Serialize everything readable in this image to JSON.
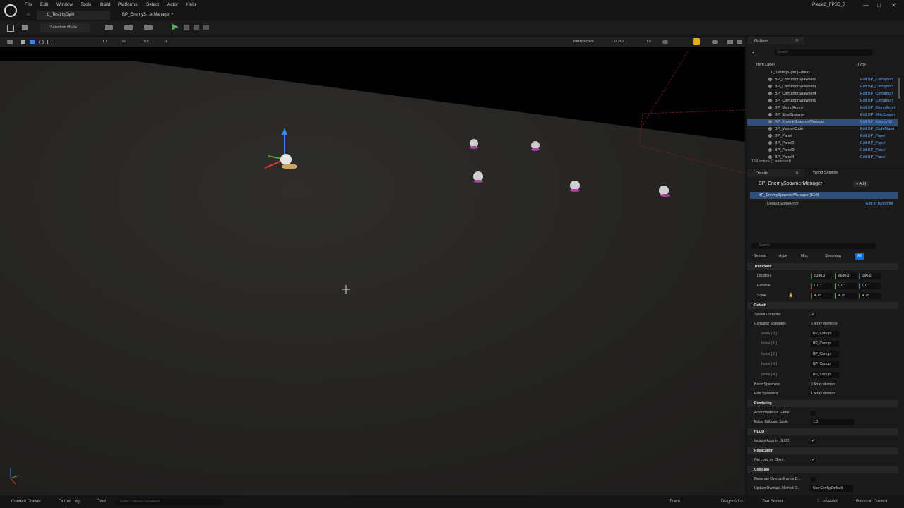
{
  "titlebar": {
    "menus": [
      "File",
      "Edit",
      "Window",
      "Tools",
      "Build",
      "Platforms",
      "Select",
      "Actor",
      "Help"
    ],
    "level_tab": "L_TestingGym",
    "bp_tab": "BP_EnemyS...erManager •",
    "project": "Piece2_FPS5_7",
    "win_min": "—",
    "win_max": "□",
    "win_close": "✕"
  },
  "toolbar": {
    "mode": "Selection Mode",
    "play": "▶"
  },
  "vp": {
    "perspective": "Perspective",
    "speed": "0.267",
    "lit": "Lit",
    "grid": "10",
    "rot": "10°",
    "fov": "50",
    "cam": "1"
  },
  "outliner": {
    "title": "Outliner",
    "search_placeholder": "Search",
    "col_label": "Item Label",
    "col_type": "Type",
    "root": "L_TestingGym (Editor)",
    "rows": [
      {
        "name": "BP_CorruptorSpawner2",
        "type": "Edit BP_Corruptor!"
      },
      {
        "name": "BP_CorruptorSpawner3",
        "type": "Edit BP_Corruptor!"
      },
      {
        "name": "BP_CorruptorSpawner4",
        "type": "Edit BP_Corruptor!"
      },
      {
        "name": "BP_CorruptorSpawner5",
        "type": "Edit BP_Corruptor!"
      },
      {
        "name": "BP_DemoRoom",
        "type": "Edit BP_DemoRoom"
      },
      {
        "name": "BP_EliteSpawner",
        "type": "Edit BP_EliteSpawn"
      },
      {
        "name": "BP_EnemySpawnerManager",
        "type": "Edit BP_EnemySp"
      },
      {
        "name": "BP_MasterCode",
        "type": "Edit BP_CodeManu"
      },
      {
        "name": "BP_Panel",
        "type": "Edit BP_Panel"
      },
      {
        "name": "BP_Panel2",
        "type": "Edit BP_Panel"
      },
      {
        "name": "BP_Panel3",
        "type": "Edit BP_Panel"
      },
      {
        "name": "BP_Panel4",
        "type": "Edit BP_Panel"
      }
    ],
    "status": "159 actors (1 selected)"
  },
  "details": {
    "tab": "Details",
    "world_tab": "World Settings",
    "actor": "BP_EnemySpawnerManager",
    "add": "+ Add",
    "self": "BP_EnemySpawnerManager (Self)",
    "root": "DefaultSceneRoot",
    "edit_bp": "Edit in Blueprint",
    "search_placeholder": "Search",
    "filters": [
      "General",
      "Actor",
      "Misc",
      "Streaming",
      "All"
    ],
    "transform": "Transform",
    "location": "Location",
    "rotation": "Rotation",
    "scale": "Scale",
    "loc": [
      "5330.0",
      "6630.0",
      "290.0"
    ],
    "rot": [
      "0.0 °",
      "0.0 °",
      "0.0 °"
    ],
    "scl": [
      "4.75",
      "4.75",
      "4.75"
    ],
    "default": "Default",
    "spawn_corruptor": "Spawn Corruptor",
    "corruptor_spawners": "Corruptor Spawners",
    "cs_count": "5 Array elements",
    "index_rows": [
      "Index [ 0 ]",
      "Index [ 1 ]",
      "Index [ 2 ]",
      "Index [ 3 ]",
      "Index [ 4 ]"
    ],
    "index_val": "BP_Corrupt",
    "basic_spawners": "Basic Spawners",
    "bs_count": "0 Array element",
    "elite_spawners": "Elite Spawners",
    "es_count": "1 Array element",
    "rendering": "Rendering",
    "hidden_in_game": "Actor Hidden In Game",
    "billboard": "Editor Billboard Scale",
    "billboard_val": "1.0",
    "hlod": "HLOD",
    "include_hlod": "Include Actor in HLOD",
    "replication": "Replication",
    "net_load": "Net Load on Client",
    "collision": "Collision",
    "gen_overlap": "Generate Overlap Events D...",
    "update_overlap": "Update Overlaps Method D...",
    "update_overlap_val": "Use Config Default"
  },
  "status": {
    "content_drawer": "Content Drawer",
    "output_log": "Output Log",
    "cmd": "Cmd",
    "console_placeholder": "Enter Console Command",
    "trace": "Trace",
    "diagnostics": "Diagnostics",
    "zen": "Zen Server",
    "unsaved": "2 Unsaved",
    "revision": "Revision Control"
  },
  "colors": {
    "accent": "#0070e0",
    "selected_row": "#2f4f7a",
    "link": "#5fa8ff"
  }
}
